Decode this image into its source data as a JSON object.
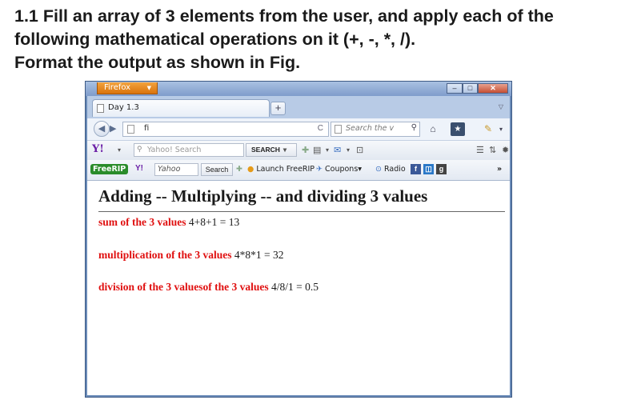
{
  "task": {
    "line1": "1.1 Fill an array of 3 elements from the user, and apply each of the",
    "line2": "following mathematical operations on it (+, -, *, /).",
    "line3": "Format the output as shown in Fig."
  },
  "browser": {
    "app_button": "Firefox",
    "tab_title": "Day 1.3",
    "new_tab": "+",
    "url": "fi",
    "search_placeholder": "Search the v",
    "yahoo_search_placeholder": "Yahoo! Search",
    "yahoo_search_button": "SEARCH",
    "freerip_logo": "FreeRIP",
    "freerip_yahoo": "Yahoo",
    "freerip_search": "Search",
    "launch_freerip": "Launch FreeRIP",
    "coupons": "Coupons",
    "radio": "Radio",
    "overflow": "»"
  },
  "page": {
    "heading": "Adding -- Multiplying -- and dividing 3 values",
    "sum_label": "sum of the 3 values",
    "sum_value": "4+8+1 = 13",
    "mult_label": "multiplication of the 3 values",
    "mult_value": "4*8*1 = 32",
    "div_label": "division of the 3 valuesof the 3 values",
    "div_value": "4/8/1 = 0.5"
  },
  "colors": {
    "label_red": "#e01010",
    "firefox_orange": "#e88a1f",
    "yahoo_purple": "#6b1fa6"
  }
}
